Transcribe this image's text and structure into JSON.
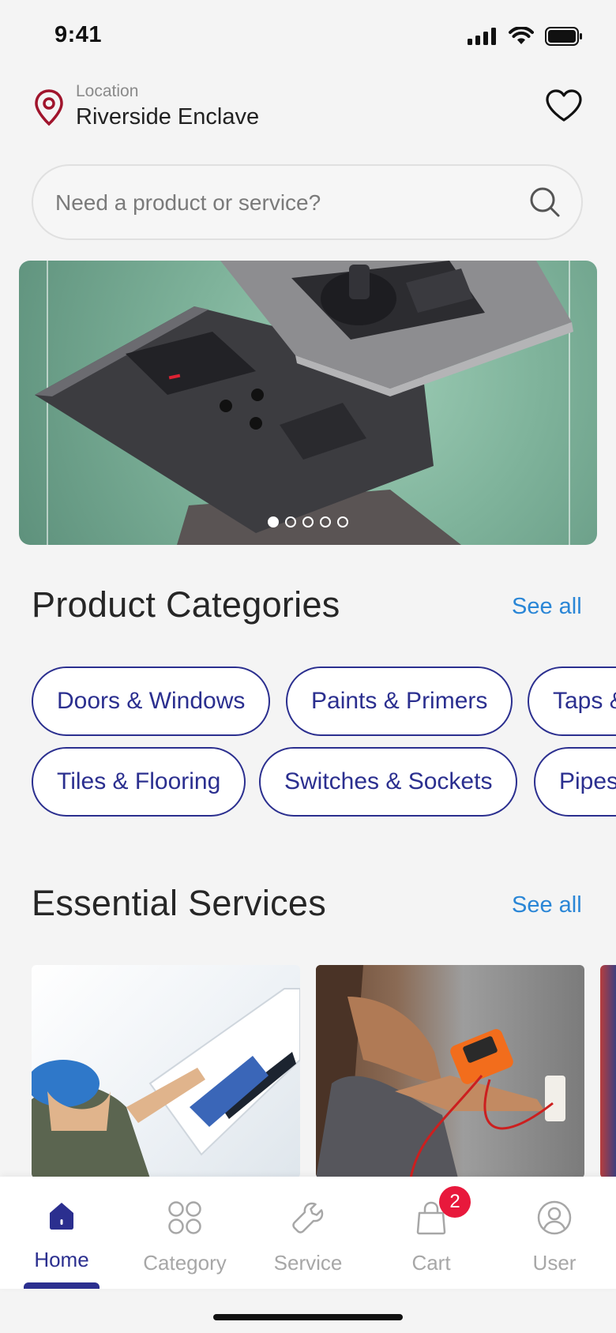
{
  "status_bar": {
    "time": "9:41"
  },
  "location": {
    "label": "Location",
    "value": "Riverside Enclave"
  },
  "search": {
    "placeholder": "Need a product or service?"
  },
  "banner": {
    "slide_count": 5,
    "active_slide": 1
  },
  "product_categories": {
    "title": "Product Categories",
    "see_all": "See all",
    "row1": [
      "Doors & Windows",
      "Paints & Primers",
      "Taps &"
    ],
    "row2": [
      "Tiles & Flooring",
      "Switches & Sockets",
      "Pipes"
    ]
  },
  "essential_services": {
    "title": "Essential Services",
    "see_all": "See all"
  },
  "bottom_nav": {
    "items": [
      {
        "label": "Home",
        "icon": "home-icon",
        "active": true
      },
      {
        "label": "Category",
        "icon": "category-grid-icon",
        "active": false
      },
      {
        "label": "Service",
        "icon": "wrench-icon",
        "active": false
      },
      {
        "label": "Cart",
        "icon": "shopping-bag-icon",
        "active": false
      },
      {
        "label": "User",
        "icon": "user-icon",
        "active": false
      }
    ],
    "cart_badge": "2"
  },
  "colors": {
    "accent": "#2b2f8f",
    "link": "#2a86d6",
    "badge": "#e8193c",
    "pin": "#a0142c"
  }
}
